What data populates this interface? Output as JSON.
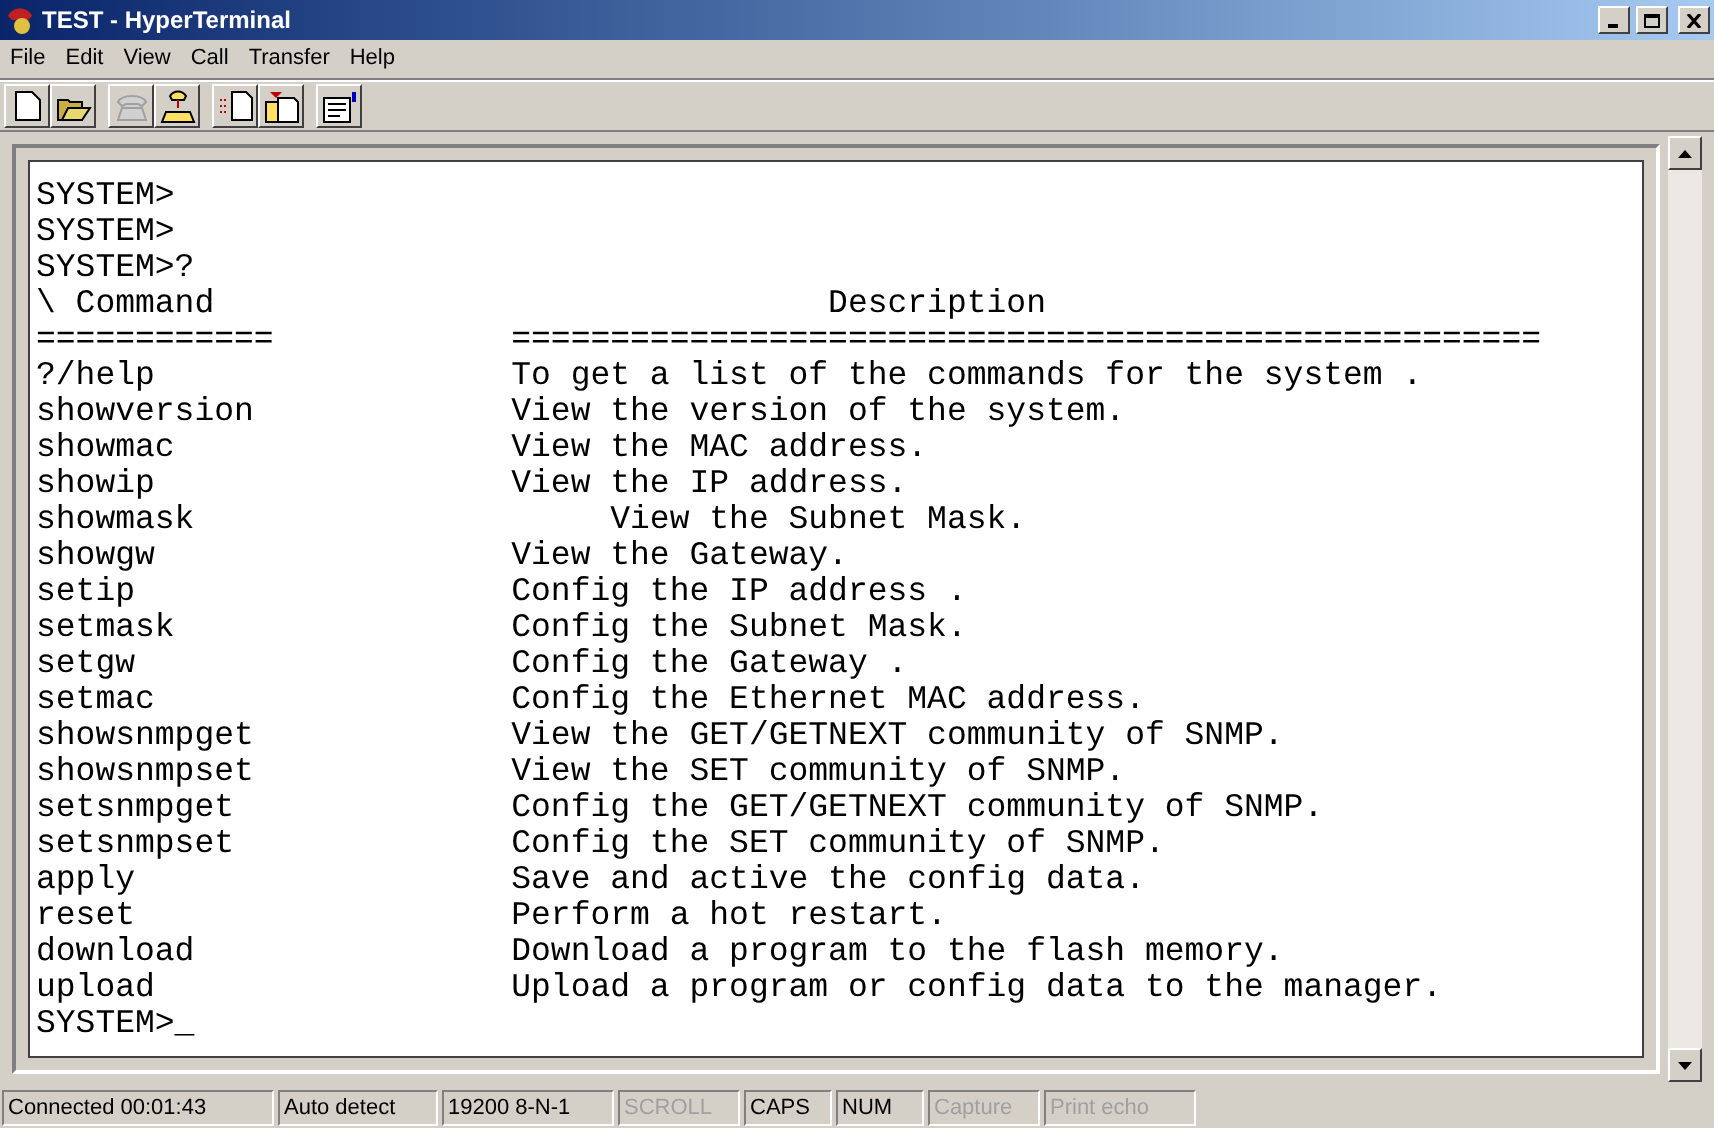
{
  "window": {
    "title": "TEST - HyperTerminal"
  },
  "menu": [
    "File",
    "Edit",
    "View",
    "Call",
    "Transfer",
    "Help"
  ],
  "toolbar": [
    [
      {
        "kind": "new",
        "disabled": false
      },
      {
        "kind": "open",
        "disabled": false
      }
    ],
    [
      {
        "kind": "disconnect",
        "disabled": true
      },
      {
        "kind": "dial",
        "disabled": false
      }
    ],
    [
      {
        "kind": "send",
        "disabled": false
      },
      {
        "kind": "receive",
        "disabled": false
      }
    ],
    [
      {
        "kind": "properties",
        "disabled": false
      }
    ]
  ],
  "terminal": {
    "lines": [
      "SYSTEM>",
      "SYSTEM>",
      "SYSTEM>?"
    ],
    "header": {
      "command": "\\ Command",
      "description": "                Description"
    },
    "rule": {
      "command": "============",
      "description": "===================================================="
    },
    "rows": [
      {
        "command": "?/help",
        "description": "To get a list of the commands for the system ."
      },
      {
        "command": "showversion",
        "description": "View the version of the system."
      },
      {
        "command": "showmac",
        "description": "View the MAC address."
      },
      {
        "command": "showip",
        "description": "View the IP address."
      },
      {
        "command": "showmask",
        "description": "     View the Subnet Mask."
      },
      {
        "command": "showgw",
        "description": "View the Gateway."
      },
      {
        "command": "setip",
        "description": "Config the IP address ."
      },
      {
        "command": "setmask",
        "description": "Config the Subnet Mask."
      },
      {
        "command": "setgw",
        "description": "Config the Gateway ."
      },
      {
        "command": "setmac",
        "description": "Config the Ethernet MAC address."
      },
      {
        "command": "showsnmpget",
        "description": "View the GET/GETNEXT community of SNMP."
      },
      {
        "command": "showsnmpset",
        "description": "View the SET community of SNMP."
      },
      {
        "command": "setsnmpget",
        "description": "Config the GET/GETNEXT community of SNMP."
      },
      {
        "command": "setsnmpset",
        "description": "Config the SET community of SNMP."
      },
      {
        "command": "apply",
        "description": "Save and active the config data."
      },
      {
        "command": "reset",
        "description": "Perform a hot restart."
      },
      {
        "command": "download",
        "description": "Download a program to the flash memory."
      },
      {
        "command": "upload",
        "description": "Upload a program or config data to the manager."
      }
    ],
    "prompt": "SYSTEM>_"
  },
  "status_bar": [
    {
      "text": "Connected 00:01:43",
      "enabled": true
    },
    {
      "text": "Auto detect",
      "enabled": true
    },
    {
      "text": "19200 8-N-1",
      "enabled": true
    },
    {
      "text": "SCROLL",
      "enabled": false
    },
    {
      "text": "CAPS",
      "enabled": true
    },
    {
      "text": "NUM",
      "enabled": true
    },
    {
      "text": "Capture",
      "enabled": false
    },
    {
      "text": "Print echo",
      "enabled": false
    }
  ]
}
